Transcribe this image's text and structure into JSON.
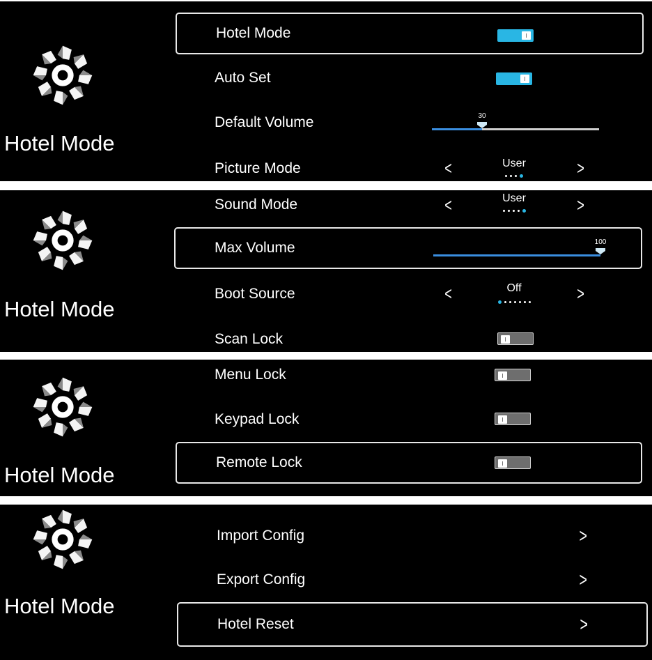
{
  "side_title": "Hotel Mode",
  "gear_icon": "gear-icon",
  "colors": {
    "accent": "#29b6e4",
    "slider_fill": "#3a8ee0",
    "background": "#000000",
    "selection_border": "#e8e8e8"
  },
  "panel1": {
    "hotel_mode": {
      "label": "Hotel Mode",
      "state": "on"
    },
    "auto_set": {
      "label": "Auto Set",
      "state": "on"
    },
    "default_volume": {
      "label": "Default Volume",
      "value": "30",
      "level": 0.3
    },
    "picture_mode": {
      "label": "Picture Mode",
      "value": "User",
      "options_count": 4,
      "selected_index": 3
    }
  },
  "panel2": {
    "sound_mode": {
      "label": "Sound Mode",
      "value": "User",
      "options_count": 5,
      "selected_index": 4
    },
    "max_volume": {
      "label": "Max Volume",
      "value": "100",
      "level": 1.0
    },
    "boot_source": {
      "label": "Boot Source",
      "value": "Off",
      "options_count": 7,
      "selected_index": 0
    },
    "scan_lock": {
      "label": "Scan Lock",
      "state": "off"
    }
  },
  "panel3": {
    "menu_lock": {
      "label": "Menu Lock",
      "state": "off"
    },
    "keypad_lock": {
      "label": "Keypad Lock",
      "state": "off"
    },
    "remote_lock": {
      "label": "Remote Lock",
      "state": "off"
    }
  },
  "panel4": {
    "import_config": {
      "label": "Import Config"
    },
    "export_config": {
      "label": "Export Config"
    },
    "hotel_reset": {
      "label": "Hotel Reset"
    }
  }
}
